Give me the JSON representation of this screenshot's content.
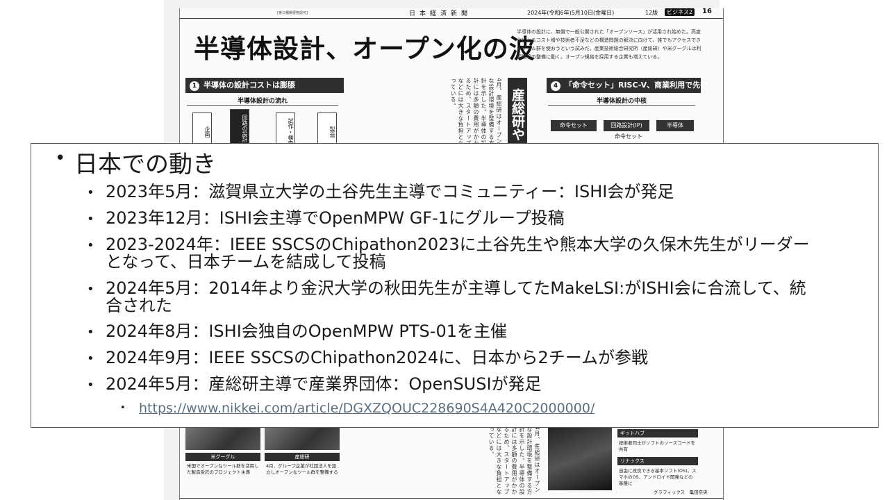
{
  "newspaper": {
    "masthead": {
      "tiny_note": "[第三種郵便物認可]",
      "name": "日本経済新聞",
      "date": "2024年(令和6年)5月10日(金曜日)",
      "edition": "12版",
      "section": "ビジネス2",
      "page": "16"
    },
    "headline": "半導体設計、オープン化の波",
    "lead": "半導体の設計に、無償で一般公開された「オープンソース」が活用され始めた。高度化によるコスト増や技術者不足などの構造問題の解決に向けて、誰でもアクセスできるツール群を使おうという試みだ。産業技術総合研究所（産総研）や米グーグルは利用環境の整備に動く。オープン規格を採用する企業も増えている。",
    "box1": {
      "number": "1",
      "title": "半導体の設計コストは膨脹",
      "subtitle": "半導体設計の流れ",
      "steps": [
        "企画",
        "回路の設計",
        "試作・検査",
        "製造"
      ]
    },
    "column_heading": "産総研や",
    "body_text": "4月、産総研はオープンな設計環境を整備する方針を示した。半導体の設計には多額の費用がかかるため、スタートアップなどには大きな負担となっている。",
    "box4": {
      "number": "4",
      "title": "「命令セット」RISC-V、商業利用で先行",
      "subtitle": "半導体設計の中核",
      "columns": [
        "命令セット",
        "回路設計(IP)",
        "半導体"
      ],
      "cell_label": "命令セット"
    },
    "photo_captions": [
      {
        "tag": "米グーグル",
        "text": "米国でオープンなツール群を活用した製造受託のプロジェクト主導"
      },
      {
        "tag": "産総研",
        "text": "4月、グループ企業が社団法人を設立しオープンなツール群を整備する"
      }
    ],
    "side_terms": [
      {
        "tag": "ギットハブ",
        "text": "技術者同士がソフトのソースコードを共有"
      },
      {
        "tag": "リナックス",
        "text": "自由に改良できる基本ソフト(OS)。スマホのOS、アンドロイド開発などの基盤に"
      }
    ],
    "graphic_credit": "グラフィックス　亀田奈央"
  },
  "slide": {
    "heading": "日本での動き",
    "bullets": [
      {
        "lines": [
          "2023年5月：滋賀県立大学の土谷先生主導でコミュニティー：ISHI会が発足"
        ]
      },
      {
        "lines": [
          "2023年12月：ISHI会主導でOpenMPW GF-1にグループ投稿"
        ]
      },
      {
        "lines": [
          "2023-2024年：IEEE SSCSのChipathon2023に土谷先生や熊本大学の久保木先生がリーダー",
          "となって、日本チームを結成して投稿"
        ]
      },
      {
        "lines": [
          "2024年5月：2014年より金沢大学の秋田先生が主導してたMakeLSI:がISHI会に合流して、統",
          "合された"
        ]
      },
      {
        "lines": [
          "2024年8月：ISHI会独自のOpenMPW PTS-01を主催"
        ]
      },
      {
        "lines": [
          "2024年9月：IEEE SSCSのChipathon2024に、日本から2チームが参戦"
        ]
      },
      {
        "lines": [
          "2024年5月：産総研主導で産業界団体：OpenSUSIが発足"
        ]
      }
    ],
    "link": "https://www.nikkei.com/article/DGXZQOUC228690S4A420C2000000/",
    "bullet_glyph": "•"
  }
}
